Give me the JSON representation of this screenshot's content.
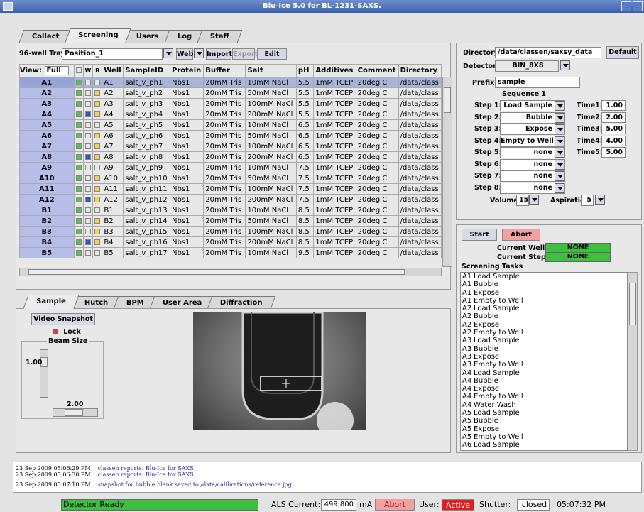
{
  "window": {
    "title": "Blu-Ice 5.0 for BL-1231-SAXS."
  },
  "main_tabs": [
    "Collect",
    "Screening",
    "Users",
    "Log",
    "Staff"
  ],
  "tray": {
    "label": "96-well Tray:",
    "value": "Position_1",
    "web_label": "Web",
    "import_label": "Import",
    "export_label": "Export",
    "edit_label": "Edit"
  },
  "table": {
    "view_label": "View:",
    "view_value": "Full",
    "col_w": "W",
    "col_b": "B",
    "headers": [
      "Well",
      "SampleID",
      "Protein",
      "Buffer",
      "Salt",
      "pH",
      "Additives",
      "Comment",
      "Directory"
    ],
    "rows": [
      {
        "well": "A1",
        "id": "A1",
        "sample": "salt_v_ph1",
        "protein": "Nbs1",
        "buffer": "20mM Tris",
        "salt": "10mM NaCl",
        "ph": "5.5",
        "add": "1mM TCEP",
        "comment": "20deg C",
        "dir": "/data/class"
      },
      {
        "well": "A2",
        "id": "A2",
        "sample": "salt_v_ph2",
        "protein": "Nbs1",
        "buffer": "20mM Tris",
        "salt": "50mM NaCl",
        "ph": "5.5",
        "add": "1mM TCEP",
        "comment": "20deg C",
        "dir": "/data/class"
      },
      {
        "well": "A3",
        "id": "A3",
        "sample": "salt_v_ph3",
        "protein": "Nbs1",
        "buffer": "20mM Tris",
        "salt": "100mM NaCl",
        "ph": "5.5",
        "add": "1mM TCEP",
        "comment": "20deg C",
        "dir": "/data/class"
      },
      {
        "well": "A4",
        "id": "A4",
        "sample": "salt_v_ph4",
        "protein": "Nbs1",
        "buffer": "20mM Tris",
        "salt": "200mM NaCl",
        "ph": "5.5",
        "add": "1mM TCEP",
        "comment": "20deg C",
        "dir": "/data/class"
      },
      {
        "well": "A5",
        "id": "A5",
        "sample": "salt_v_ph5",
        "protein": "Nbs1",
        "buffer": "20mM Tris",
        "salt": "10mM NaCl",
        "ph": "6.5",
        "add": "1mM TCEP",
        "comment": "20deg C",
        "dir": "/data/class"
      },
      {
        "well": "A6",
        "id": "A6",
        "sample": "salt_v_ph6",
        "protein": "Nbs1",
        "buffer": "20mM Tris",
        "salt": "50mM NaCl",
        "ph": "6.5",
        "add": "1mM TCEP",
        "comment": "20deg C",
        "dir": "/data/class"
      },
      {
        "well": "A7",
        "id": "A7",
        "sample": "salt_v_ph7",
        "protein": "Nbs1",
        "buffer": "20mM Tris",
        "salt": "100mM NaCl",
        "ph": "6.5",
        "add": "1mM TCEP",
        "comment": "20deg C",
        "dir": "/data/class"
      },
      {
        "well": "A8",
        "id": "A8",
        "sample": "salt_v_ph8",
        "protein": "Nbs1",
        "buffer": "20mM Tris",
        "salt": "200mM NaCl",
        "ph": "6.5",
        "add": "1mM TCEP",
        "comment": "20deg C",
        "dir": "/data/class"
      },
      {
        "well": "A9",
        "id": "A9",
        "sample": "salt_v_ph9",
        "protein": "Nbs1",
        "buffer": "20mM Tris",
        "salt": "10mM NaCl",
        "ph": "7.5",
        "add": "1mM TCEP",
        "comment": "20deg C",
        "dir": "/data/class"
      },
      {
        "well": "A10",
        "id": "A10",
        "sample": "salt_v_ph10",
        "protein": "Nbs1",
        "buffer": "20mM Tris",
        "salt": "50mM NaCl",
        "ph": "7.5",
        "add": "1mM TCEP",
        "comment": "20deg C",
        "dir": "/data/class"
      },
      {
        "well": "A11",
        "id": "A11",
        "sample": "salt_v_ph11",
        "protein": "Nbs1",
        "buffer": "20mM Tris",
        "salt": "100mM NaCl",
        "ph": "7.5",
        "add": "1mM TCEP",
        "comment": "20deg C",
        "dir": "/data/class"
      },
      {
        "well": "A12",
        "id": "A12",
        "sample": "salt_v_ph12",
        "protein": "Nbs1",
        "buffer": "20mM Tris",
        "salt": "200mM NaCl",
        "ph": "7.5",
        "add": "1mM TCEP",
        "comment": "20deg C",
        "dir": "/data/class"
      },
      {
        "well": "B1",
        "id": "B1",
        "sample": "salt_v_ph13",
        "protein": "Nbs1",
        "buffer": "20mM Tris",
        "salt": "10mM NaCl",
        "ph": "8.5",
        "add": "1mM TCEP",
        "comment": "20deg C",
        "dir": "/data/class"
      },
      {
        "well": "B2",
        "id": "B2",
        "sample": "salt_v_ph14",
        "protein": "Nbs1",
        "buffer": "20mM Tris",
        "salt": "50mM NaCl",
        "ph": "8.5",
        "add": "1mM TCEP",
        "comment": "20deg C",
        "dir": "/data/class"
      },
      {
        "well": "B3",
        "id": "B3",
        "sample": "salt_v_ph15",
        "protein": "Nbs1",
        "buffer": "20mM Tris",
        "salt": "100mM NaCl",
        "ph": "8.5",
        "add": "1mM TCEP",
        "comment": "20deg C",
        "dir": "/data/class"
      },
      {
        "well": "B4",
        "id": "B4",
        "sample": "salt_v_ph16",
        "protein": "Nbs1",
        "buffer": "20mM Tris",
        "salt": "200mM NaCl",
        "ph": "8.5",
        "add": "1mM TCEP",
        "comment": "20deg C",
        "dir": "/data/class"
      },
      {
        "well": "B5",
        "id": "B5",
        "sample": "salt_v_ph17",
        "protein": "Nbs1",
        "buffer": "20mM Tris",
        "salt": "10mM NaCl",
        "ph": "9.5",
        "add": "1mM TCEP",
        "comment": "20deg C",
        "dir": "/data/class"
      }
    ]
  },
  "directory": {
    "label": "Directory:",
    "value": "/data/classen/saxsy_data",
    "default_label": "Default"
  },
  "detector": {
    "label": "Detector:",
    "value": "BIN_8X8"
  },
  "prefix": {
    "label": "Prefix:",
    "value": "sample"
  },
  "sequence": {
    "title": "Sequence 1",
    "steps": [
      {
        "label": "Step 1:",
        "value": "Load Sample"
      },
      {
        "label": "Step 2:",
        "value": "Bubble"
      },
      {
        "label": "Step 3:",
        "value": "Expose"
      },
      {
        "label": "Step 4:",
        "value": "Empty to Well"
      },
      {
        "label": "Step 5:",
        "value": "none"
      },
      {
        "label": "Step 6:",
        "value": "none"
      },
      {
        "label": "Step 7:",
        "value": "none"
      },
      {
        "label": "Step 8:",
        "value": "none"
      }
    ],
    "times": [
      {
        "label": "Time1:",
        "value": "1.00"
      },
      {
        "label": "Time2:",
        "value": "2.00"
      },
      {
        "label": "Time3:",
        "value": "5.00"
      },
      {
        "label": "Time4:",
        "value": "4.00"
      },
      {
        "label": "Time5:",
        "value": "5.00"
      }
    ],
    "volume_label": "Volume",
    "volume_value": "15",
    "aspiration_label": "Aspiration",
    "aspiration_value": "5"
  },
  "control": {
    "start_label": "Start",
    "abort_label": "Abort",
    "current_well_label": "Current Well:",
    "current_well_value": "NONE",
    "current_step_label": "Current Step:",
    "current_step_value": "NONE",
    "tasks_label": "Screening Tasks",
    "tasks": [
      {
        "well": "A1",
        "task": "Load Sample"
      },
      {
        "well": "A1",
        "task": "Bubble"
      },
      {
        "well": "A1",
        "task": "Expose"
      },
      {
        "well": "A1",
        "task": "Empty to Well"
      },
      {
        "well": "A2",
        "task": "Load Sample"
      },
      {
        "well": "A2",
        "task": "Bubble"
      },
      {
        "well": "A2",
        "task": "Expose"
      },
      {
        "well": "A2",
        "task": "Empty to Well"
      },
      {
        "well": "A3",
        "task": "Load Sample"
      },
      {
        "well": "A3",
        "task": "Bubble"
      },
      {
        "well": "A3",
        "task": "Expose"
      },
      {
        "well": "A3",
        "task": "Empty to Well"
      },
      {
        "well": "A4",
        "task": "Load Sample"
      },
      {
        "well": "A4",
        "task": "Bubble"
      },
      {
        "well": "A4",
        "task": "Expose"
      },
      {
        "well": "A4",
        "task": "Empty to Well"
      },
      {
        "well": "A4",
        "task": "Water Wash"
      },
      {
        "well": "A5",
        "task": "Load Sample"
      },
      {
        "well": "A5",
        "task": "Bubble"
      },
      {
        "well": "A5",
        "task": "Expose"
      },
      {
        "well": "A5",
        "task": "Empty to Well"
      },
      {
        "well": "A6",
        "task": "Load Sample"
      }
    ]
  },
  "sample_tabs": [
    "Sample",
    "Hutch",
    "BPM",
    "User Area",
    "Diffraction"
  ],
  "sample": {
    "video_snapshot_label": "Video Snapshot",
    "lock_label": "Lock",
    "beam_size_label": "Beam Size",
    "beam_v_value": "1.00",
    "beam_h_value": "2.00"
  },
  "log": [
    {
      "time": "23 Sep 2009 05:06:29 PM",
      "msg": "classen reports: Blu-Ice for SAXS"
    },
    {
      "time": "23 Sep 2009 05:06:30 PM",
      "msg": "classen reports: Blu-Ice for SAXS"
    },
    {
      "time": "23 Sep 2009 05:07:10 PM",
      "msg": "snapshot for bubble blank saved to /data/calibrations/reference.jpg"
    }
  ],
  "statusbar": {
    "detector_status": "Detector Ready",
    "als_label": "ALS Current:",
    "als_value": "499.800",
    "als_unit": "mA",
    "abort_label": "Abort",
    "user_label": "User:",
    "user_value": "Active",
    "shutter_label": "Shutter:",
    "shutter_value": "closed",
    "clock": "05:07:32 PM"
  },
  "colors": {
    "title_bar": "#3b5fa8",
    "well_column": "#b5bde8",
    "status_green": "#3fbf3f",
    "abort_pink": "#f2a0a0",
    "active_red": "#e02020"
  }
}
